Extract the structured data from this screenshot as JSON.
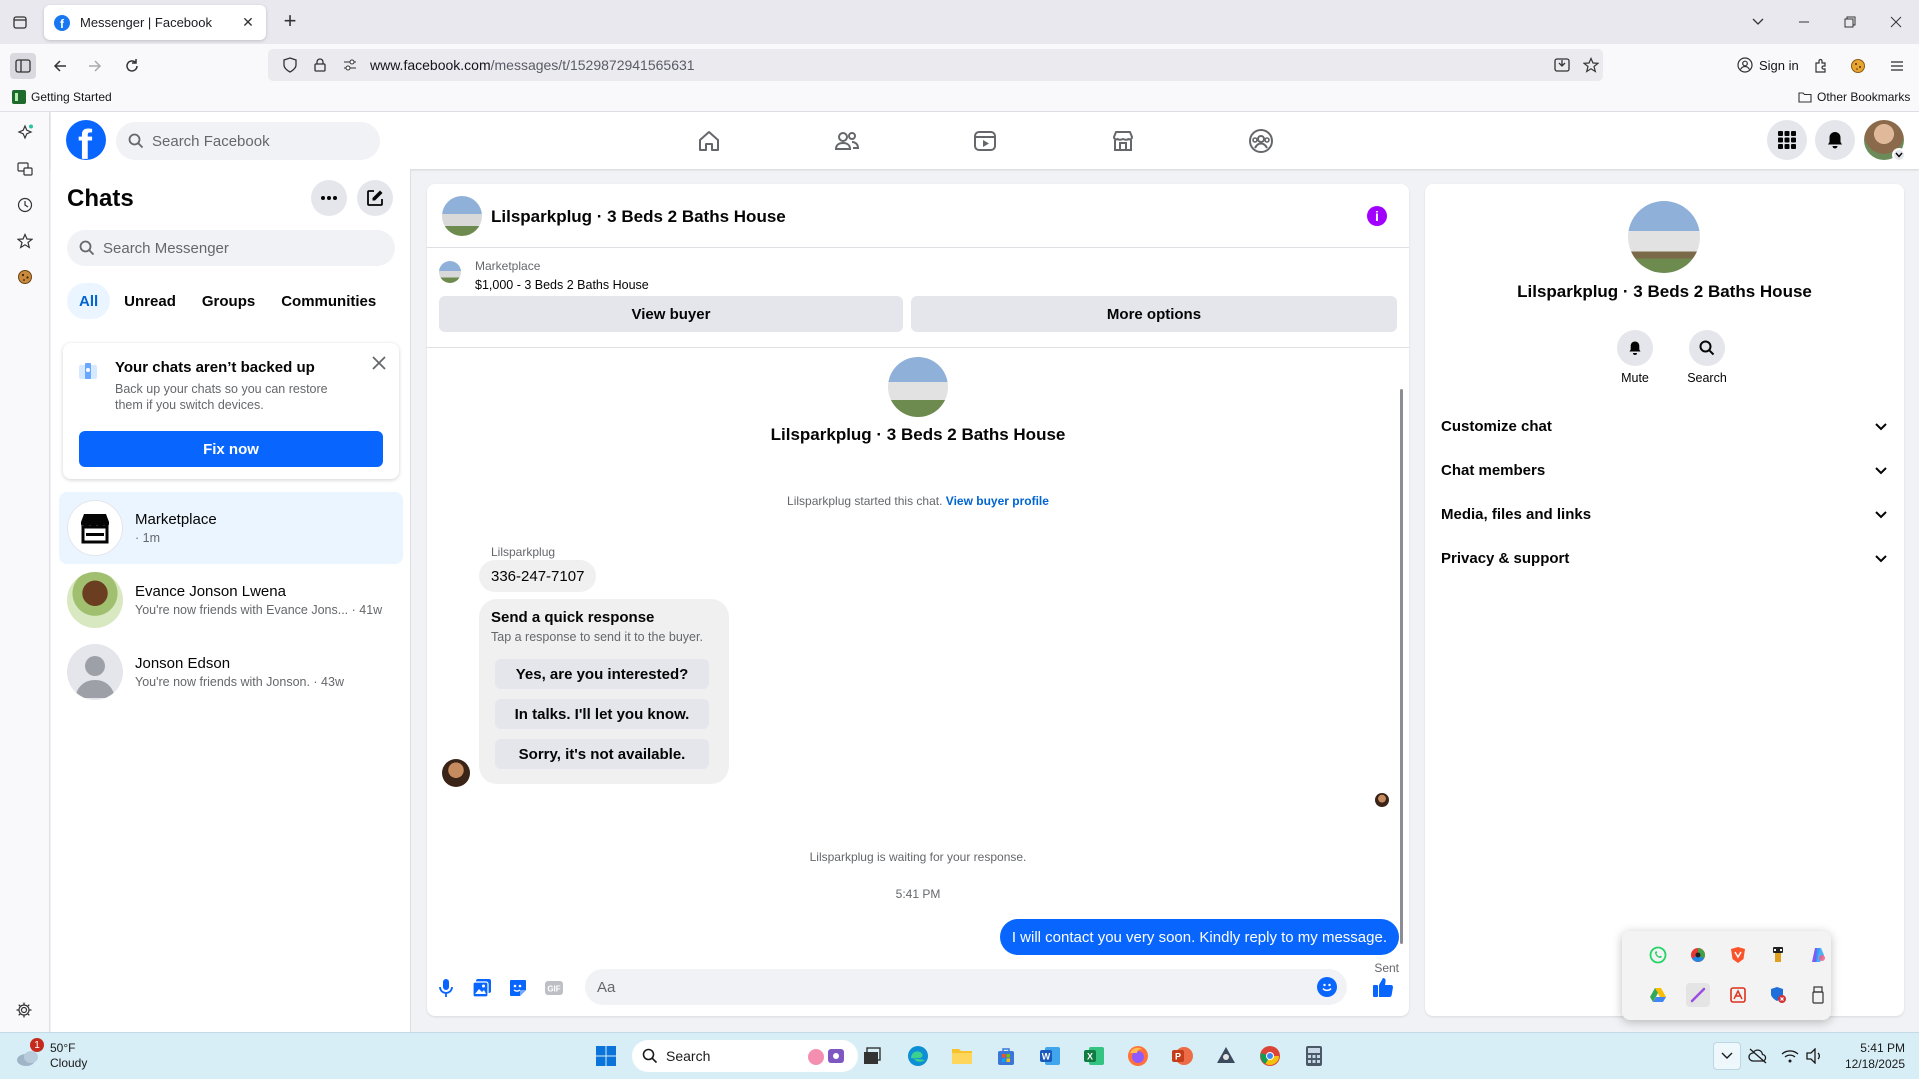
{
  "browser": {
    "tab_title": "Messenger | Facebook",
    "url_host": "www.facebook.com",
    "url_path": "/messages/t/1529872941565631",
    "signin_label": "Sign in",
    "bookmark_getting_started": "Getting Started",
    "bookmark_other": "Other Bookmarks"
  },
  "fb": {
    "logo": "f",
    "search_placeholder": "Search Facebook",
    "nav_icons": [
      "home-icon",
      "friends-icon",
      "video-icon",
      "marketplace-icon",
      "groups-icon"
    ]
  },
  "chats": {
    "title": "Chats",
    "search_placeholder": "Search Messenger",
    "filters": [
      "All",
      "Unread",
      "Groups",
      "Communities"
    ],
    "active_filter": "All",
    "backup": {
      "title": "Your chats aren’t backed up",
      "description": "Back up your chats so you can restore them if you switch devices.",
      "button": "Fix now"
    },
    "conversations": [
      {
        "name": "Marketplace",
        "snippet": "· 1m"
      },
      {
        "name": "Evance Jonson Lwena",
        "snippet": "You're now friends with Evance Jons... · 41w"
      },
      {
        "name": "Jonson Edson",
        "snippet": "You're now friends with Jonson. · 43w"
      }
    ]
  },
  "conversation": {
    "title": "Lilsparkplug · 3 Beds 2 Baths House",
    "marketplace_label": "Marketplace",
    "listing": "$1,000 - 3 Beds 2 Baths House",
    "view_buyer": "View buyer",
    "more_options": "More options",
    "started_text": "Lilsparkplug started this chat.",
    "view_buyer_profile": "View buyer profile",
    "sender": "Lilsparkplug",
    "phone": "336-247-7107",
    "quick_title": "Send a quick response",
    "quick_desc": "Tap a response to send it to the buyer.",
    "quick_responses": [
      "Yes, are you interested?",
      "In talks. I'll let you know.",
      "Sorry, it's not available."
    ],
    "waiting": "Lilsparkplug is waiting for your response.",
    "time": "5:41 PM",
    "my_message": "I will contact you very soon. Kindly reply to my message.",
    "sent": "Sent",
    "input_placeholder": "Aa"
  },
  "details": {
    "name": "Lilsparkplug · 3 Beds 2 Baths House",
    "actions": [
      "Mute",
      "Search"
    ],
    "sections": [
      "Customize chat",
      "Chat members",
      "Media, files and links",
      "Privacy & support"
    ]
  },
  "taskbar": {
    "weather_temp": "50°F",
    "weather_desc": "Cloudy",
    "weather_badge": "1",
    "search_label": "Search",
    "time": "5:41 PM",
    "date": "12/18/2025"
  },
  "colors": {
    "fb_blue": "#0866ff",
    "accent_purple": "#a100ff",
    "active_chat_bg": "#ebf5ff"
  }
}
